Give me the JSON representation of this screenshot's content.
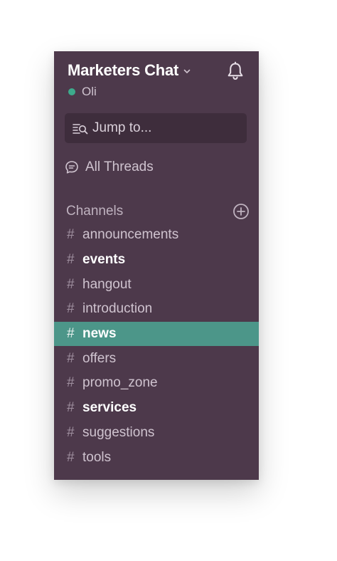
{
  "workspace": {
    "team_name": "Marketers Chat",
    "user_name": "Oli",
    "presence": "active",
    "presence_color": "#3daa8c"
  },
  "colors": {
    "sidebar_bg": "#4d394b",
    "active_channel_bg": "#4c9689",
    "jump_bg": "#3e2d3c"
  },
  "icons": {
    "team_menu": "chevron-down-icon",
    "notifications": "bell-icon",
    "jump": "quick-switcher-icon",
    "threads": "threads-icon",
    "add_channel": "plus-circle-icon"
  },
  "jump_to": {
    "label": "Jump to..."
  },
  "threads": {
    "label": "All Threads"
  },
  "channels": {
    "title": "Channels",
    "hash": "#",
    "items": [
      {
        "name": "announcements",
        "bold": false,
        "active": false
      },
      {
        "name": "events",
        "bold": true,
        "active": false
      },
      {
        "name": "hangout",
        "bold": false,
        "active": false
      },
      {
        "name": "introduction",
        "bold": false,
        "active": false
      },
      {
        "name": "news",
        "bold": false,
        "active": true
      },
      {
        "name": "offers",
        "bold": false,
        "active": false
      },
      {
        "name": "promo_zone",
        "bold": false,
        "active": false
      },
      {
        "name": "services",
        "bold": true,
        "active": false
      },
      {
        "name": "suggestions",
        "bold": false,
        "active": false
      },
      {
        "name": "tools",
        "bold": false,
        "active": false
      }
    ]
  }
}
